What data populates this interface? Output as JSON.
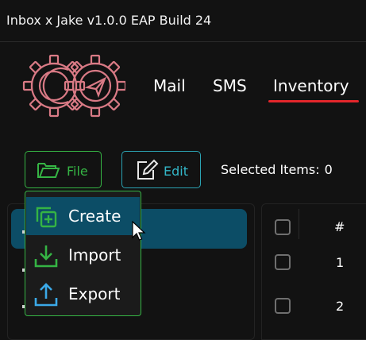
{
  "window": {
    "title": "Inbox x Jake v1.0.0 EAP Build 24"
  },
  "logo": {
    "icon": "gear-logo-icon",
    "color": "#d97a85"
  },
  "nav": {
    "items": [
      {
        "label": "Mail",
        "active": false
      },
      {
        "label": "SMS",
        "active": false
      },
      {
        "label": "Inventory",
        "active": true
      }
    ],
    "active_color": "#e3262b"
  },
  "toolbar": {
    "file_label": "File",
    "file_icon": "folder-open-icon",
    "edit_label": "Edit",
    "edit_icon": "pencil-square-icon",
    "selected_label": "Selected Items:",
    "selected_count": "0",
    "file_color": "#35b444",
    "edit_color": "#33b7c8"
  },
  "file_menu": {
    "items": [
      {
        "label": "Create",
        "icon": "create-copy-icon",
        "highlighted": true
      },
      {
        "label": "Import",
        "icon": "download-tray-icon",
        "highlighted": false
      },
      {
        "label": "Export",
        "icon": "upload-tray-icon",
        "highlighted": false
      }
    ],
    "highlight_color": "#0c4d66"
  },
  "table": {
    "header": "#",
    "rows": [
      {
        "index": "1"
      },
      {
        "index": "2"
      }
    ]
  }
}
